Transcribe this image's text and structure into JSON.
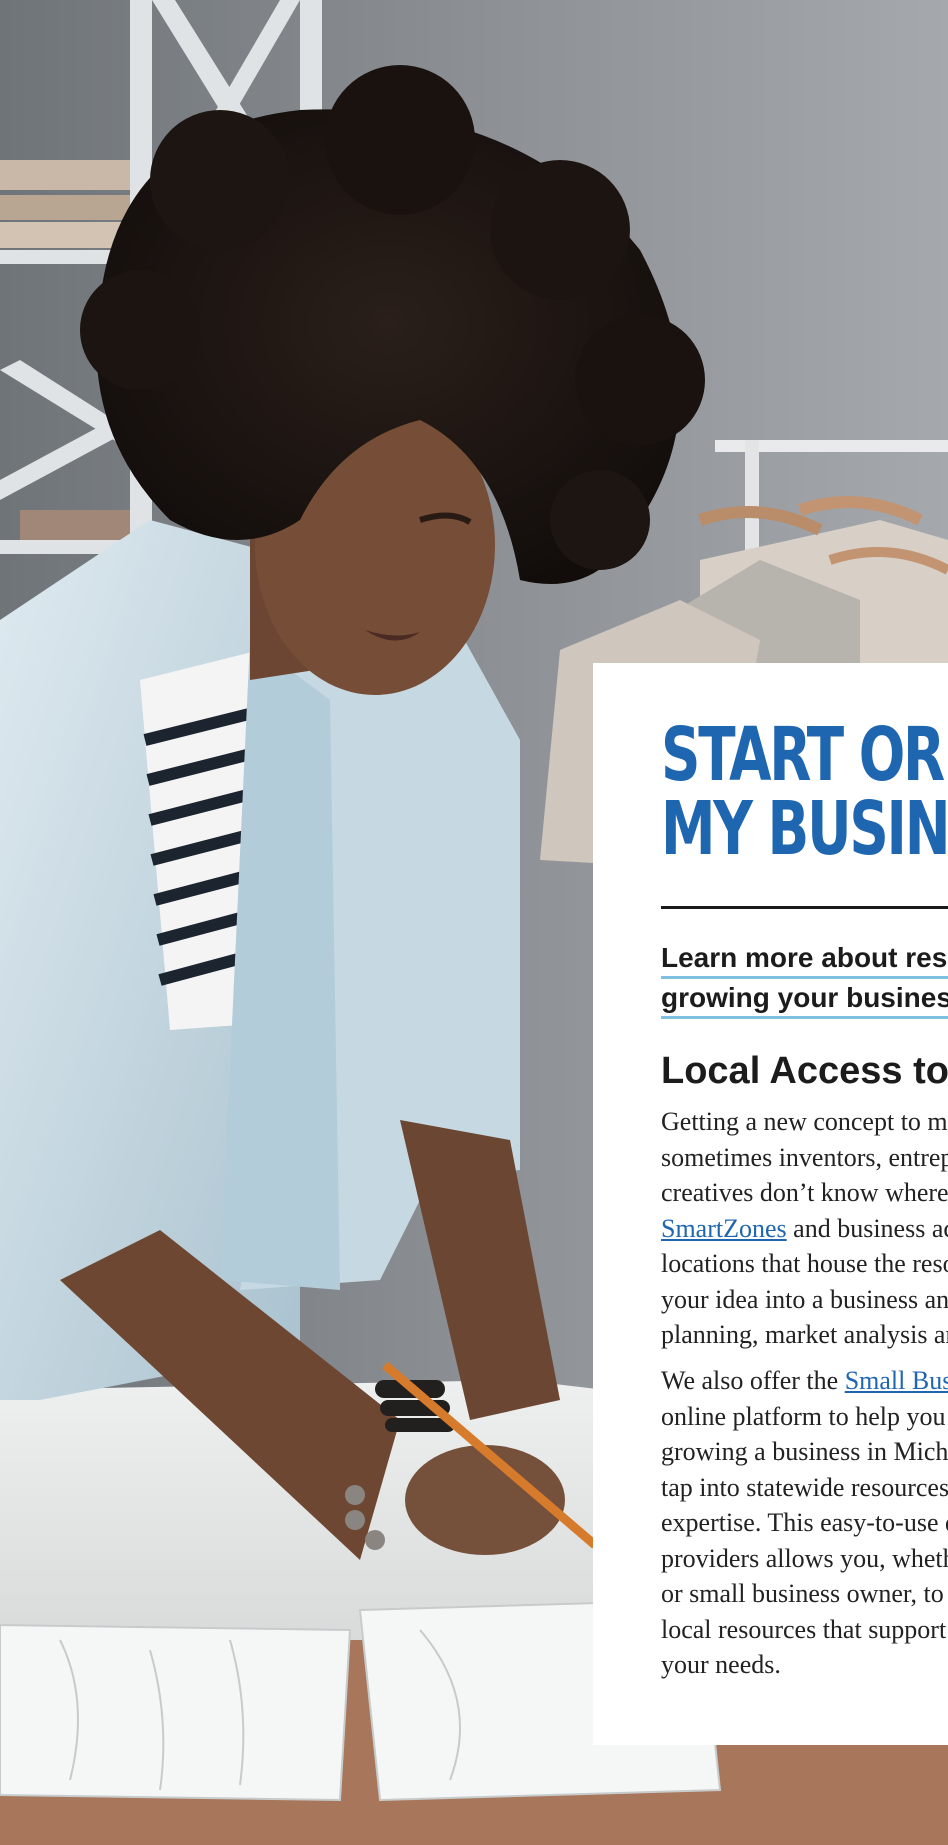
{
  "card": {
    "title_lines": [
      "START OR GROW",
      "MY BUSINESS"
    ],
    "subtitle_lines": [
      "Learn more about resources for",
      "growing your business"
    ],
    "section_heading": "Local Access to Resources",
    "paragraph1": {
      "line1": "Getting a new concept to market can be daunting;",
      "line2": "sometimes inventors, entrepreneurs and",
      "line3": "creatives don’t know where to start. Michigan’s",
      "line4_link": "SmartZones",
      "line4_rest": " and business accelerators are",
      "line5": "locations that house the resources you need to turn",
      "line6": "your idea into a business and include business",
      "line7": "planning, market analysis and more."
    },
    "paragraph2": {
      "line1_pre": "We also offer the ",
      "line1_link": "Small Business Navigator",
      "line2": "online platform to help you with starting and",
      "line3": "growing a business in Michigan, and for you to",
      "line4": "tap into statewide resources and industry",
      "line5": "expertise. This easy-to-use directory of service",
      "line6": "providers allows you, whether you’re an entrepreneur",
      "line7": "or small business owner, to connect with",
      "line8": "local resources that support",
      "line9": "your needs."
    }
  },
  "colors": {
    "title_blue": "#1f66b0",
    "underline_blue": "#7fc0e2",
    "link_blue": "#1f66b0"
  }
}
